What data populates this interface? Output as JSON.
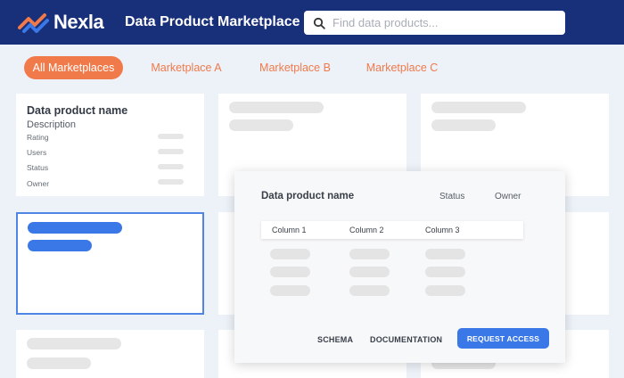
{
  "header": {
    "logo_text": "Nexla",
    "title": "Data Product Marketplace",
    "search_placeholder": "Find data products..."
  },
  "tabs": [
    {
      "label": "All Marketplaces",
      "active": true
    },
    {
      "label": "Marketplace A",
      "active": false
    },
    {
      "label": "Marketplace B",
      "active": false
    },
    {
      "label": "Marketplace C",
      "active": false
    }
  ],
  "card": {
    "title": "Data product name",
    "description": "Description",
    "fields": [
      "Rating",
      "Users",
      "Status",
      "Owner"
    ]
  },
  "detail": {
    "title": "Data product name",
    "status_label": "Status",
    "owner_label": "Owner",
    "columns": [
      "Column 1",
      "Column 2",
      "Column 3"
    ],
    "schema_label": "SCHEMA",
    "documentation_label": "DOCUMENTATION",
    "request_label": "REQUEST ACCESS"
  },
  "colors": {
    "header_bg": "#182f7a",
    "accent_orange": "#f07a4a",
    "accent_blue": "#3b78e7",
    "page_bg": "#edf2f9"
  }
}
